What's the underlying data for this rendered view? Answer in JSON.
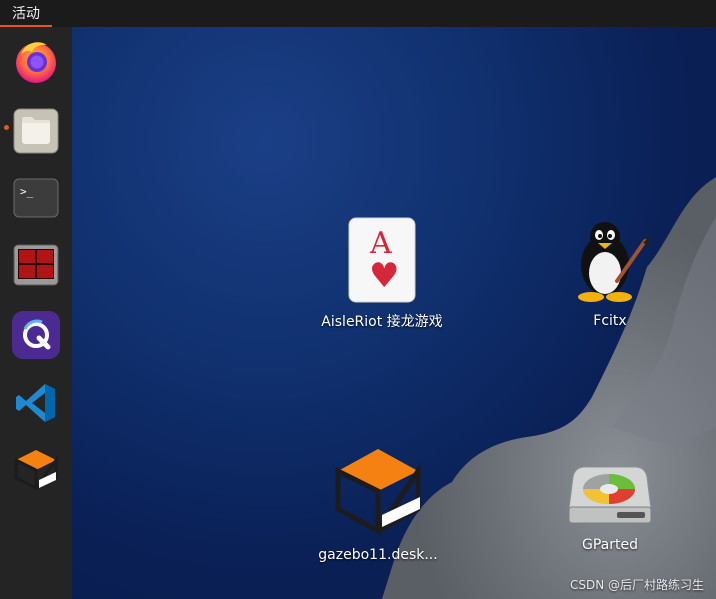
{
  "topbar": {
    "activities_label": "活动"
  },
  "dock": {
    "items": [
      {
        "name": "Firefox",
        "icon": "firefox-icon"
      },
      {
        "name": "Files",
        "icon": "files-icon",
        "running": true
      },
      {
        "name": "Terminal",
        "icon": "terminal-icon",
        "glyph": ">_"
      },
      {
        "name": "Terminator",
        "icon": "terminator-icon"
      },
      {
        "name": "QQ",
        "icon": "q-app-icon",
        "glyph": "Q"
      },
      {
        "name": "Visual Studio Code",
        "icon": "vscode-icon"
      },
      {
        "name": "Gazebo",
        "icon": "gazebo-icon"
      }
    ]
  },
  "desktop": {
    "icons": [
      {
        "label": "AisleRiot 接龙游戏",
        "icon": "playing-card-icon",
        "card_rank": "A",
        "card_suit": "♥"
      },
      {
        "label": "Fcitx",
        "icon": "penguin-icon"
      },
      {
        "label": "gazebo11.desk...",
        "icon": "gazebo-icon"
      },
      {
        "label": "GParted",
        "icon": "hard-disk-icon"
      }
    ]
  },
  "watermark": "CSDN @后厂村路练习生",
  "colors": {
    "accent": "#e95420",
    "topbar": "#1b1b1b",
    "dock": "#242424"
  }
}
